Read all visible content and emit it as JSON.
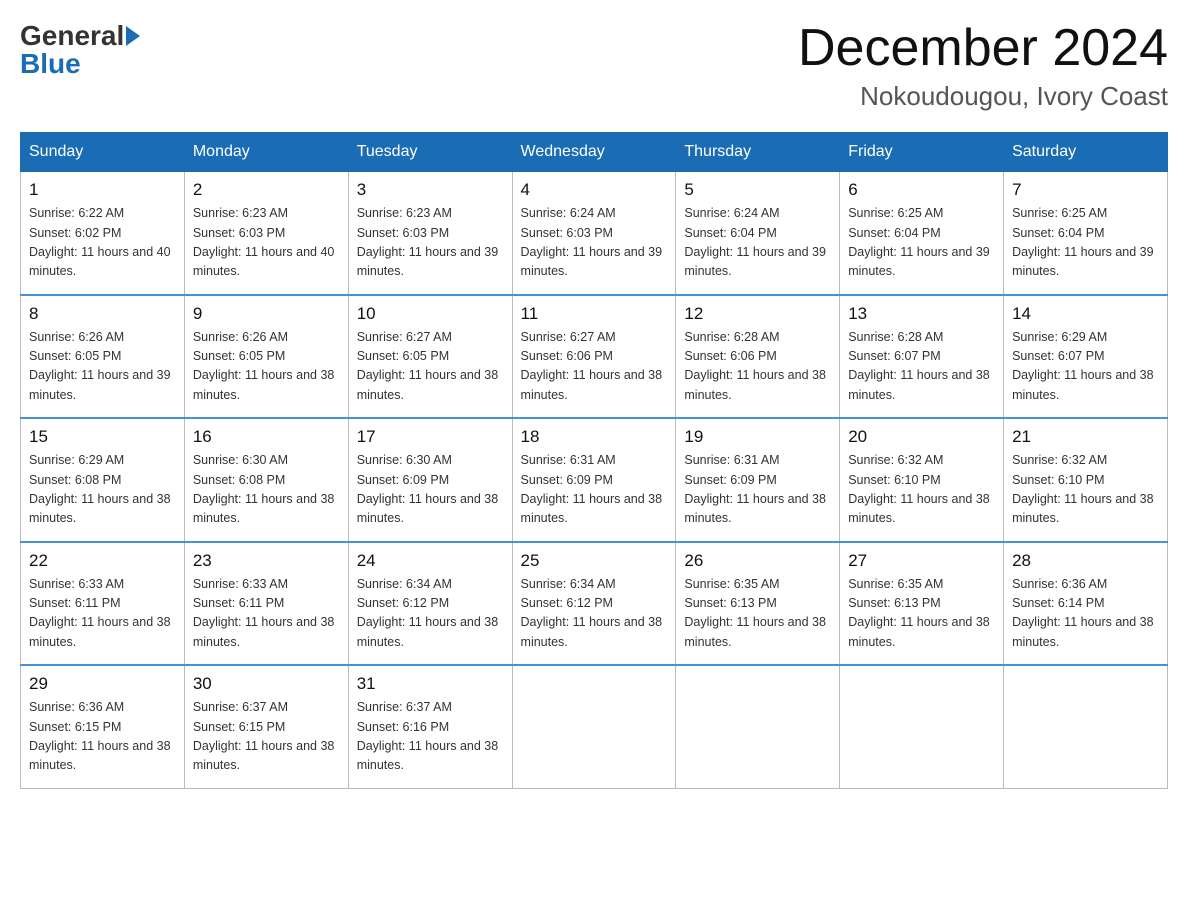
{
  "header": {
    "logo_general": "General",
    "logo_blue": "Blue",
    "month_title": "December 2024",
    "location": "Nokoudougou, Ivory Coast"
  },
  "days_of_week": [
    "Sunday",
    "Monday",
    "Tuesday",
    "Wednesday",
    "Thursday",
    "Friday",
    "Saturday"
  ],
  "weeks": [
    [
      {
        "day": "1",
        "sunrise": "6:22 AM",
        "sunset": "6:02 PM",
        "daylight": "11 hours and 40 minutes."
      },
      {
        "day": "2",
        "sunrise": "6:23 AM",
        "sunset": "6:03 PM",
        "daylight": "11 hours and 40 minutes."
      },
      {
        "day": "3",
        "sunrise": "6:23 AM",
        "sunset": "6:03 PM",
        "daylight": "11 hours and 39 minutes."
      },
      {
        "day": "4",
        "sunrise": "6:24 AM",
        "sunset": "6:03 PM",
        "daylight": "11 hours and 39 minutes."
      },
      {
        "day": "5",
        "sunrise": "6:24 AM",
        "sunset": "6:04 PM",
        "daylight": "11 hours and 39 minutes."
      },
      {
        "day": "6",
        "sunrise": "6:25 AM",
        "sunset": "6:04 PM",
        "daylight": "11 hours and 39 minutes."
      },
      {
        "day": "7",
        "sunrise": "6:25 AM",
        "sunset": "6:04 PM",
        "daylight": "11 hours and 39 minutes."
      }
    ],
    [
      {
        "day": "8",
        "sunrise": "6:26 AM",
        "sunset": "6:05 PM",
        "daylight": "11 hours and 39 minutes."
      },
      {
        "day": "9",
        "sunrise": "6:26 AM",
        "sunset": "6:05 PM",
        "daylight": "11 hours and 38 minutes."
      },
      {
        "day": "10",
        "sunrise": "6:27 AM",
        "sunset": "6:05 PM",
        "daylight": "11 hours and 38 minutes."
      },
      {
        "day": "11",
        "sunrise": "6:27 AM",
        "sunset": "6:06 PM",
        "daylight": "11 hours and 38 minutes."
      },
      {
        "day": "12",
        "sunrise": "6:28 AM",
        "sunset": "6:06 PM",
        "daylight": "11 hours and 38 minutes."
      },
      {
        "day": "13",
        "sunrise": "6:28 AM",
        "sunset": "6:07 PM",
        "daylight": "11 hours and 38 minutes."
      },
      {
        "day": "14",
        "sunrise": "6:29 AM",
        "sunset": "6:07 PM",
        "daylight": "11 hours and 38 minutes."
      }
    ],
    [
      {
        "day": "15",
        "sunrise": "6:29 AM",
        "sunset": "6:08 PM",
        "daylight": "11 hours and 38 minutes."
      },
      {
        "day": "16",
        "sunrise": "6:30 AM",
        "sunset": "6:08 PM",
        "daylight": "11 hours and 38 minutes."
      },
      {
        "day": "17",
        "sunrise": "6:30 AM",
        "sunset": "6:09 PM",
        "daylight": "11 hours and 38 minutes."
      },
      {
        "day": "18",
        "sunrise": "6:31 AM",
        "sunset": "6:09 PM",
        "daylight": "11 hours and 38 minutes."
      },
      {
        "day": "19",
        "sunrise": "6:31 AM",
        "sunset": "6:09 PM",
        "daylight": "11 hours and 38 minutes."
      },
      {
        "day": "20",
        "sunrise": "6:32 AM",
        "sunset": "6:10 PM",
        "daylight": "11 hours and 38 minutes."
      },
      {
        "day": "21",
        "sunrise": "6:32 AM",
        "sunset": "6:10 PM",
        "daylight": "11 hours and 38 minutes."
      }
    ],
    [
      {
        "day": "22",
        "sunrise": "6:33 AM",
        "sunset": "6:11 PM",
        "daylight": "11 hours and 38 minutes."
      },
      {
        "day": "23",
        "sunrise": "6:33 AM",
        "sunset": "6:11 PM",
        "daylight": "11 hours and 38 minutes."
      },
      {
        "day": "24",
        "sunrise": "6:34 AM",
        "sunset": "6:12 PM",
        "daylight": "11 hours and 38 minutes."
      },
      {
        "day": "25",
        "sunrise": "6:34 AM",
        "sunset": "6:12 PM",
        "daylight": "11 hours and 38 minutes."
      },
      {
        "day": "26",
        "sunrise": "6:35 AM",
        "sunset": "6:13 PM",
        "daylight": "11 hours and 38 minutes."
      },
      {
        "day": "27",
        "sunrise": "6:35 AM",
        "sunset": "6:13 PM",
        "daylight": "11 hours and 38 minutes."
      },
      {
        "day": "28",
        "sunrise": "6:36 AM",
        "sunset": "6:14 PM",
        "daylight": "11 hours and 38 minutes."
      }
    ],
    [
      {
        "day": "29",
        "sunrise": "6:36 AM",
        "sunset": "6:15 PM",
        "daylight": "11 hours and 38 minutes."
      },
      {
        "day": "30",
        "sunrise": "6:37 AM",
        "sunset": "6:15 PM",
        "daylight": "11 hours and 38 minutes."
      },
      {
        "day": "31",
        "sunrise": "6:37 AM",
        "sunset": "6:16 PM",
        "daylight": "11 hours and 38 minutes."
      },
      null,
      null,
      null,
      null
    ]
  ]
}
